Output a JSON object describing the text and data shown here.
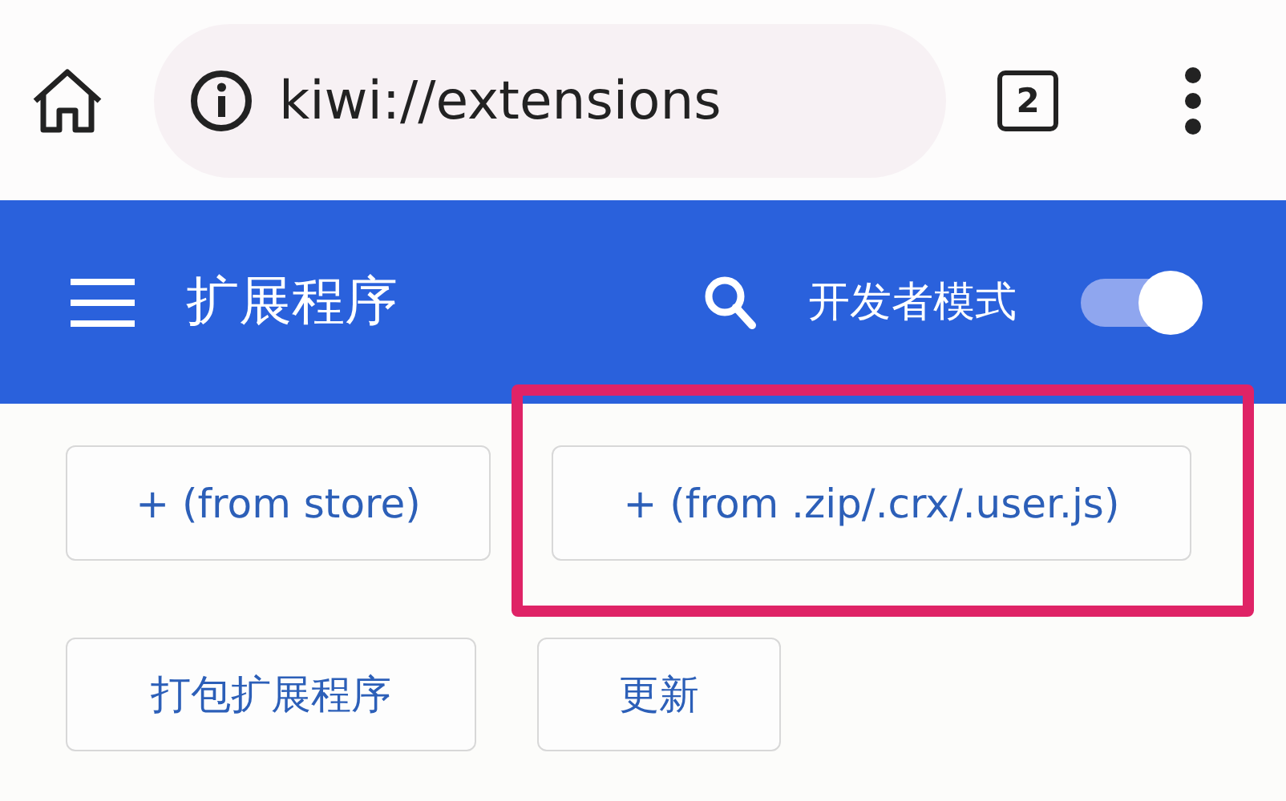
{
  "browser_bar": {
    "url": "kiwi://extensions",
    "tab_count": "2"
  },
  "header": {
    "title": "扩展程序",
    "developer_mode": {
      "label": "开发者模式",
      "on": true
    }
  },
  "buttons": [
    [
      {
        "label": "+ (from store)",
        "highlighted": false
      },
      {
        "label": "+ (from .zip/.crx/.user.js)",
        "highlighted": true
      }
    ],
    [
      {
        "label": "打包扩展程序",
        "highlighted": false
      },
      {
        "label": "更新",
        "highlighted": false
      }
    ]
  ]
}
